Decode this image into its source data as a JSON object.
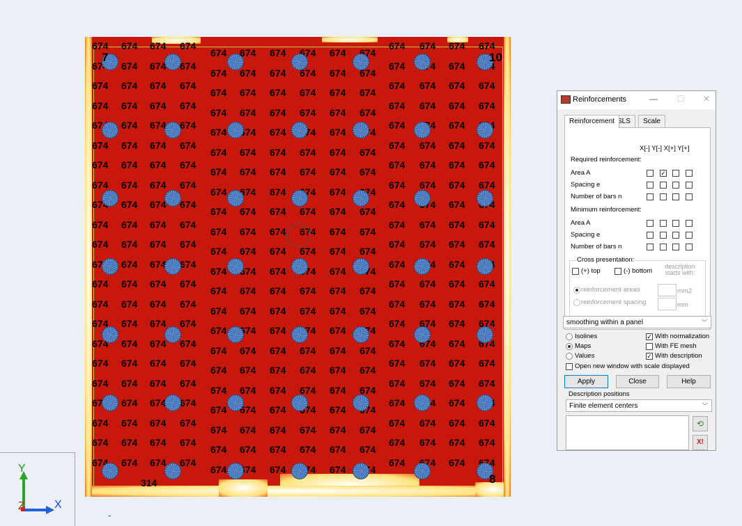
{
  "map": {
    "value_label": "674",
    "low_label": "314",
    "node_labels": {
      "top_left": "7",
      "top_right": "10",
      "bottom_right": "8"
    },
    "colors": {
      "field": "#c8170b",
      "column": "#5d8fd6",
      "edge_low": "#ffffff"
    }
  },
  "axis": {
    "y": "Y",
    "x": "X",
    "z": "Z",
    "marker": "-"
  },
  "dialog": {
    "title": "Reinforcements",
    "tabs": [
      "Reinforcement",
      "SLS",
      "Scale"
    ],
    "col_headers": "X[-] Y[-] X[+] Y[+]",
    "required_header": "Required reinforcement:",
    "minimum_header": "Minimum reinforcement:",
    "rows": {
      "area": "Area A",
      "spacing": "Spacing e",
      "bars": "Number of bars n"
    },
    "cross": {
      "legend": "Cross presentation:",
      "top": "(+) top",
      "bottom": "(-) bottom",
      "desc": "description starts with:",
      "areas": "reinforcement areas",
      "spacing": "reinforcement spacing",
      "unit_area": "mm2",
      "unit_len": "mm"
    },
    "smoothing": "smoothing within a panel",
    "opt_isolines": "Isolines",
    "opt_maps": "Maps",
    "opt_values": "Values",
    "chk_norm": "With normalization",
    "chk_mesh": "With FE mesh",
    "chk_desc": "With description",
    "chk_window": "Open new window with scale displayed",
    "apply": "Apply",
    "close": "Close",
    "help": "Help",
    "desc_positions": "Description positions",
    "desc_select": "Finite element centers"
  }
}
